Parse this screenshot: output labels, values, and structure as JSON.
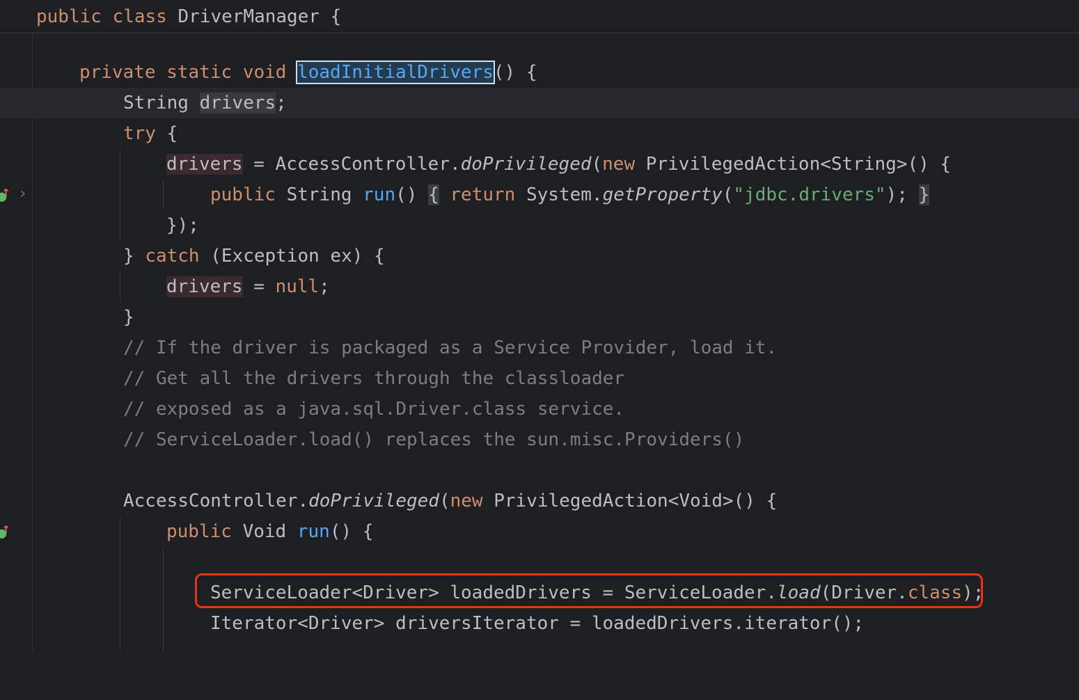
{
  "sticky_header": {
    "kw1": "public",
    "kw2": "class",
    "name": "DriverManager",
    "brace": "{"
  },
  "lines": {
    "l1": {
      "kw1": "private",
      "kw2": "static",
      "kw3": "void",
      "method": "loadInitialDrivers",
      "rest": "() {"
    },
    "l2": {
      "type": "String",
      "var": "drivers",
      "semi": ";"
    },
    "l3": {
      "kw": "try",
      "rest": " {"
    },
    "l4": {
      "var": "drivers",
      "a": " = AccessController.",
      "method": "doPrivileged",
      "b": "(",
      "kw": "new",
      "c": " PrivilegedAction<String>() {"
    },
    "l5": {
      "kw": "public",
      "a": " String ",
      "method": "run",
      "b": "() ",
      "brace1": "{",
      "kw2": "return",
      "c": " System.",
      "method2": "getProperty",
      "d": "(",
      "str": "\"jdbc.drivers\"",
      "e": ");",
      "brace2": "}"
    },
    "l6": {
      "text": "});"
    },
    "l7": {
      "a": "} ",
      "kw": "catch",
      "b": " (Exception ex) {"
    },
    "l8": {
      "var": "drivers",
      "a": " = ",
      "kw": "null",
      "b": ";"
    },
    "l9": {
      "text": "}"
    },
    "c1": "// If the driver is packaged as a Service Provider, load it.",
    "c2": "// Get all the drivers through the classloader",
    "c3": "// exposed as a java.sql.Driver.class service.",
    "c4": "// ServiceLoader.load() replaces the sun.misc.Providers()",
    "l10": {
      "a": "AccessController.",
      "method": "doPrivileged",
      "b": "(",
      "kw": "new",
      "c": " PrivilegedAction<Void>() {"
    },
    "l11": {
      "kw": "public",
      "a": " Void ",
      "method": "run",
      "b": "() {"
    },
    "l12": {
      "a": "ServiceLoader<Driver> loadedDrivers = ServiceLoader.",
      "method": "load",
      "b": "(Driver.",
      "kw": "class",
      "c": ");"
    },
    "l13": {
      "text": "Iterator<Driver> driversIterator = loadedDrivers.iterator();"
    }
  },
  "gutter": {
    "override_arrow": "↑",
    "fold_chevron": "›"
  },
  "colors": {
    "background": "#1e1f22",
    "keyword": "#cf8e6d",
    "method": "#56a8f5",
    "string": "#6aab73",
    "comment": "#7a7e85",
    "highlight_box": "#e8321a"
  }
}
